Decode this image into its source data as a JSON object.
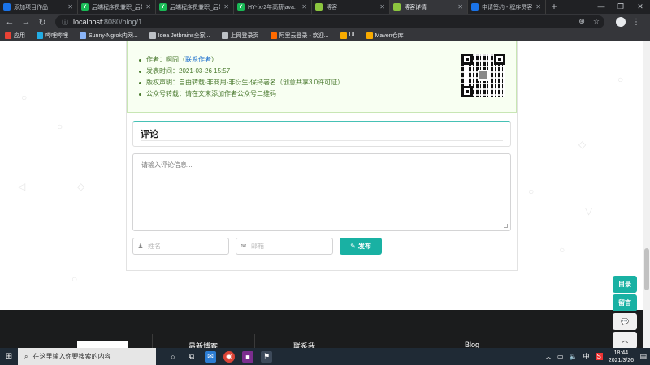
{
  "browser": {
    "tabs": [
      {
        "label": "添加项目作品",
        "fav_color": "#1a73e8",
        "fav_text": ""
      },
      {
        "label": "后端程序员兼职_后端",
        "fav_color": "#19b955",
        "fav_text": "Y"
      },
      {
        "label": "后端程序员兼职_后端",
        "fav_color": "#19b955",
        "fav_text": "Y"
      },
      {
        "label": "HY-fx-2年高薪java.",
        "fav_color": "#19b955",
        "fav_text": "Y"
      },
      {
        "label": "博客",
        "fav_color": "#8cc63f",
        "fav_text": ""
      },
      {
        "label": "博客详情",
        "fav_color": "#8cc63f",
        "fav_text": ""
      },
      {
        "label": "申请签约 - 程序员客栈",
        "fav_color": "#1a73e8",
        "fav_text": ""
      }
    ],
    "active_tab_index": 5,
    "new_tab": "+",
    "window_controls": [
      "—",
      "❐",
      "✕"
    ],
    "url_host": "localhost",
    "url_path": ":8080/blog/1",
    "bookmarks": [
      {
        "label": "应用",
        "color": "#e94235"
      },
      {
        "label": "哔哩哔哩",
        "color": "#23ade5"
      },
      {
        "label": "Sunny-Ngrok内网...",
        "color": "#8ab4f8"
      },
      {
        "label": "Idea Jetbrains全家...",
        "color": "#bdc1c6"
      },
      {
        "label": "上网登录页",
        "color": "#bdc1c6"
      },
      {
        "label": "阿里云登录 - 欢迎...",
        "color": "#ff6a00"
      },
      {
        "label": "UI",
        "color": "#f9ab00"
      },
      {
        "label": "Maven仓库",
        "color": "#f9ab00"
      }
    ]
  },
  "blog": {
    "info_items": [
      {
        "text": "作者：啊囧（",
        "link": "联系作者",
        "tail": "）"
      },
      {
        "text": "发表时间：2021-03-26 15:57"
      },
      {
        "text": "版权声明：自由转载-非商用-非衍生-保持署名（创意共享3.0许可证）"
      },
      {
        "text": "公众号转载：请在文末添加作者公众号二维码"
      }
    ],
    "comment_title": "评论",
    "comment_placeholder": "请输入评论信息...",
    "name_placeholder": "姓名",
    "email_placeholder": "邮箱",
    "publish_label": "发布"
  },
  "side_tools": {
    "toc": "目录",
    "message": "留言",
    "wechat": "✉",
    "top": "︿"
  },
  "footer": {
    "latest": "最新博客",
    "contact": "联系我",
    "blog": "Blog"
  },
  "taskbar": {
    "search_placeholder": "在这里输入你要搜索的内容",
    "ime": "中",
    "time": "18:44",
    "date": "2021/3/26"
  },
  "colors": {
    "accent": "#19b1a3",
    "info_bg": "#f8fff2",
    "info_text": "#4a7a2f"
  }
}
